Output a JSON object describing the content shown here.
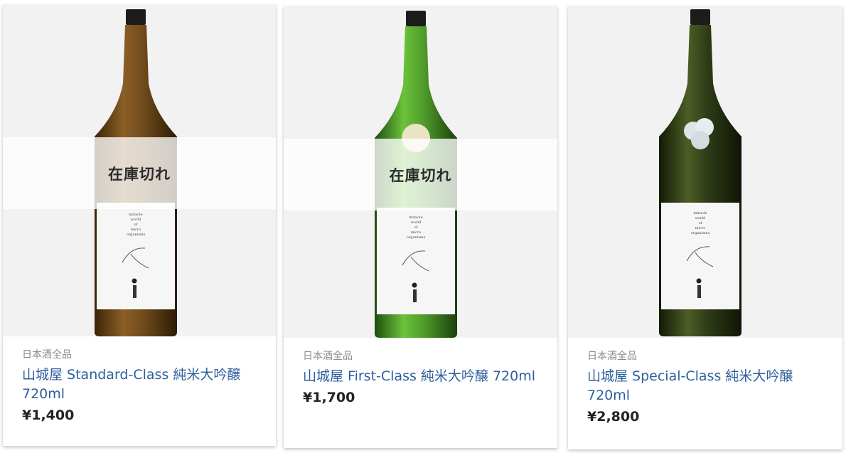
{
  "products": [
    {
      "category": "日本酒全品",
      "name": "山城屋 Standard-Class 純米大吟醸 720ml",
      "price": "¥1,400",
      "sold_out": true,
      "sold_out_label": "在庫切れ",
      "bottle_color": "#6e4a1a"
    },
    {
      "category": "日本酒全品",
      "name": "山城屋 First-Class 純米大吟醸 720ml",
      "price": "¥1,700",
      "sold_out": true,
      "sold_out_label": "在庫切れ",
      "bottle_color": "#4f9a2b"
    },
    {
      "category": "日本酒全品",
      "name": "山城屋 Special-Class 純米大吟醸 720ml",
      "price": "¥2,800",
      "sold_out": false,
      "bottle_color": "#2d3a16"
    }
  ]
}
